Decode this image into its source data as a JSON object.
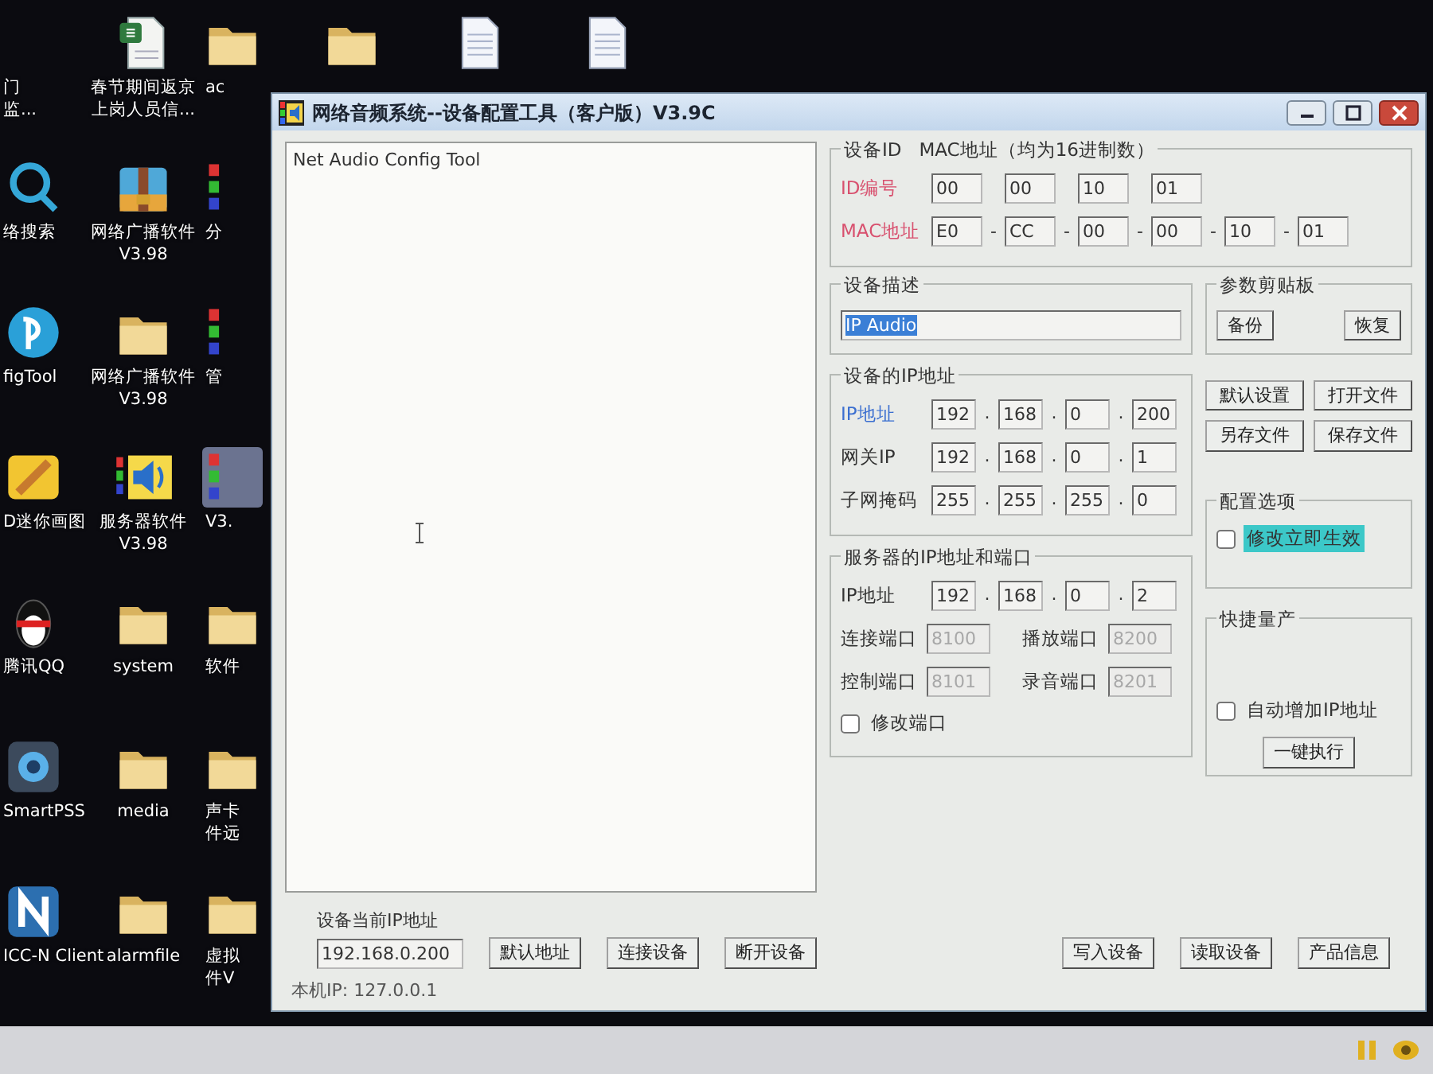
{
  "desktop": {
    "rows": [
      [
        {
          "kind": "none",
          "lines": [
            "门",
            "监..."
          ]
        },
        {
          "kind": "spreadsheet",
          "lines": [
            "春节期间返京",
            "上岗人员信..."
          ],
          "selected": false
        },
        {
          "kind": "folder",
          "label": "ac",
          "selected": false
        },
        {
          "kind": "folder",
          "selected": false
        },
        {
          "kind": "document",
          "selected": false
        },
        {
          "kind": "document",
          "selected": false
        }
      ],
      [
        {
          "kind": "search",
          "label": "络搜索",
          "selected": false
        },
        {
          "kind": "archive",
          "label": "网络广播软件\nV3.98",
          "selected": false
        },
        {
          "kind": "bars",
          "label": "分",
          "selected": false
        }
      ],
      [
        {
          "kind": "config",
          "label": "figTool",
          "selected": false
        },
        {
          "kind": "folder",
          "label": "网络广播软件\nV3.98",
          "selected": false
        },
        {
          "kind": "bars",
          "label": "管",
          "selected": false
        }
      ],
      [
        {
          "kind": "paint",
          "label": "D迷你画图",
          "selected": false
        },
        {
          "kind": "speaker",
          "label": "服务器软件\nV3.98",
          "selected": false
        },
        {
          "kind": "bars",
          "label": "V3.",
          "selected": true
        }
      ],
      [
        {
          "kind": "penguin",
          "label": "腾讯QQ",
          "selected": false
        },
        {
          "kind": "folder",
          "label": "system",
          "selected": false
        },
        {
          "kind": "folder",
          "label": "软件",
          "selected": false
        }
      ],
      [
        {
          "kind": "camera",
          "label": "SmartPSS",
          "selected": false
        },
        {
          "kind": "folder",
          "label": "media",
          "selected": false
        },
        {
          "kind": "folder",
          "lines": [
            "声卡",
            "件远"
          ],
          "selected": false
        }
      ],
      [
        {
          "kind": "tile",
          "label": "ICC-N Client",
          "selected": false
        },
        {
          "kind": "folder",
          "label": "alarmfile",
          "selected": false
        },
        {
          "kind": "folder",
          "lines": [
            "虚拟",
            "件V"
          ],
          "selected": false
        }
      ]
    ]
  },
  "window": {
    "title": "网络音频系统--设备配置工具（客户版）V3.9C"
  },
  "log": {
    "lines": [
      "Net Audio Config Tool"
    ]
  },
  "id_group": {
    "title": "设备ID   MAC地址（均为16进制数）",
    "rows": [
      {
        "label": "ID编号",
        "color": "#d8506e",
        "fields": [
          "00",
          "00",
          "10",
          "01"
        ]
      },
      {
        "label": "MAC地址",
        "color": "#d8506e",
        "separator": "-",
        "fields": [
          "E0",
          "CC",
          "00",
          "00",
          "10",
          "01"
        ]
      }
    ]
  },
  "description": {
    "title": "设备描述",
    "value": "IP Audio",
    "text_selected": true
  },
  "clipboard": {
    "title": "参数剪贴板",
    "buttons": [
      "备份",
      "恢复"
    ]
  },
  "file_buttons": [
    "默认设置",
    "打开文件",
    "另存文件",
    "保存文件"
  ],
  "device_ip": {
    "title": "设备的IP地址",
    "separator": ".",
    "rows": [
      {
        "label": "IP地址",
        "color": "#3b6fd0",
        "octets": [
          "192",
          "168",
          "0",
          "200"
        ]
      },
      {
        "label": "网关IP",
        "color": "#333333",
        "octets": [
          "192",
          "168",
          "0",
          "1"
        ]
      },
      {
        "label": "子网掩码",
        "color": "#333333",
        "octets": [
          "255",
          "255",
          "255",
          "0"
        ]
      }
    ]
  },
  "server": {
    "title": "服务器的IP地址和端口",
    "separator": ".",
    "ip": {
      "label": "IP地址",
      "octets": [
        "192",
        "168",
        "0",
        "2"
      ]
    },
    "ports": [
      {
        "label": "连接端口",
        "value": "8100",
        "disabled": true
      },
      {
        "label": "播放端口",
        "value": "8200",
        "disabled": true
      },
      {
        "label": "控制端口",
        "value": "8101",
        "disabled": true
      },
      {
        "label": "录音端口",
        "value": "8201",
        "disabled": true
      }
    ],
    "modify_ports": {
      "label": "修改端口",
      "checked": false
    }
  },
  "config_options": {
    "title": "配置选项",
    "checkbox": {
      "label": "修改立即生效",
      "checked": false,
      "focused": true
    }
  },
  "batch": {
    "title": "快捷量产",
    "checkbox": {
      "label": "自动增加IP地址",
      "checked": false,
      "focused": false
    },
    "button": "一键执行"
  },
  "bottom": {
    "current_ip_label": "设备当前IP地址",
    "current_ip": "192.168.0.200",
    "left_buttons": [
      "默认地址",
      "连接设备",
      "断开设备"
    ],
    "right_buttons": [
      "写入设备",
      "读取设备",
      "产品信息"
    ]
  },
  "status_bar": {
    "text": "本机IP: 127.0.0.1"
  }
}
